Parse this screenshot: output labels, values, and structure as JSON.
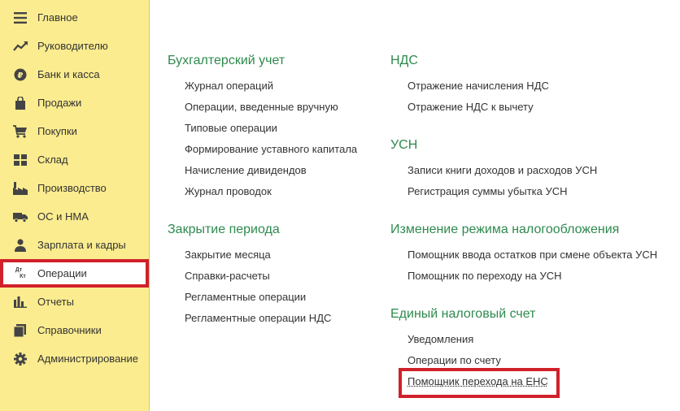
{
  "sidebar": {
    "items": [
      {
        "label": "Главное",
        "icon": "menu-icon"
      },
      {
        "label": "Руководителю",
        "icon": "trend-icon"
      },
      {
        "label": "Банк и касса",
        "icon": "ruble-icon"
      },
      {
        "label": "Продажи",
        "icon": "bag-icon"
      },
      {
        "label": "Покупки",
        "icon": "cart-icon"
      },
      {
        "label": "Склад",
        "icon": "warehouse-icon"
      },
      {
        "label": "Производство",
        "icon": "factory-icon"
      },
      {
        "label": "ОС и НМА",
        "icon": "truck-icon"
      },
      {
        "label": "Зарплата и кадры",
        "icon": "person-icon"
      },
      {
        "label": "Операции",
        "icon": "debit-credit-icon",
        "icon_text_top": "Дт",
        "icon_text_bottom": "Кт",
        "active": true
      },
      {
        "label": "Отчеты",
        "icon": "bar-chart-icon"
      },
      {
        "label": "Справочники",
        "icon": "books-icon"
      },
      {
        "label": "Администрирование",
        "icon": "gear-icon"
      }
    ]
  },
  "sections": {
    "accounting": {
      "title": "Бухгалтерский учет",
      "links": [
        "Журнал операций",
        "Операции, введенные вручную",
        "Типовые операции",
        "Формирование уставного капитала",
        "Начисление дивидендов",
        "Журнал проводок"
      ]
    },
    "period_close": {
      "title": "Закрытие периода",
      "links": [
        "Закрытие месяца",
        "Справки-расчеты",
        "Регламентные операции",
        "Регламентные операции НДС"
      ]
    },
    "vat": {
      "title": "НДС",
      "links": [
        "Отражение начисления НДС",
        "Отражение НДС к вычету"
      ]
    },
    "usn": {
      "title": "УСН",
      "links": [
        "Записи книги доходов и расходов УСН",
        "Регистрация суммы убытка УСН"
      ]
    },
    "tax_regime": {
      "title": "Изменение режима налогообложения",
      "links": [
        "Помощник ввода остатков при смене объекта УСН",
        "Помощник по переходу на УСН"
      ]
    },
    "ens": {
      "title": "Единый налоговый счет",
      "links": [
        "Уведомления",
        "Операции по счету",
        "Помощник перехода на ЕНС"
      ]
    }
  },
  "colors": {
    "sidebar_bg": "#fbec8f",
    "section_title": "#2e8a4e",
    "highlight_red": "#d0212a"
  }
}
